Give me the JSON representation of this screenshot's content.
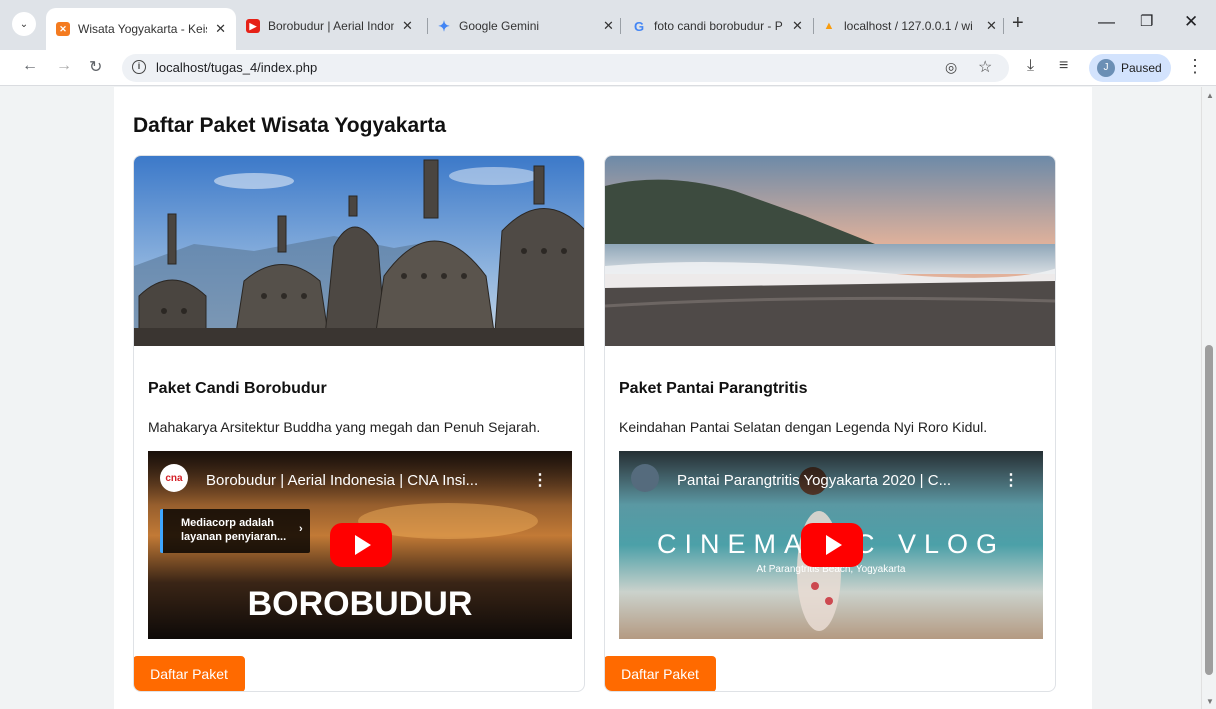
{
  "browser": {
    "tabs": [
      {
        "title": "Wisata Yogyakarta - Keist",
        "active": true
      },
      {
        "title": "Borobudur | Aerial Indone"
      },
      {
        "title": "Google Gemini"
      },
      {
        "title": "foto candi borobudur - P"
      },
      {
        "title": "localhost / 127.0.0.1 / wi"
      }
    ],
    "url": "localhost/tugas_4/index.php",
    "profile_label": "Paused",
    "profile_initial": "J"
  },
  "page": {
    "heading": "Daftar Paket Wisata Yogyakarta",
    "cards": [
      {
        "title": "Paket Candi Borobudur",
        "description": "Mahakarya Arsitektur Buddha yang megah dan Penuh Sejarah.",
        "video": {
          "title": "Borobudur | Aerial Indonesia | CNA Insi...",
          "channel_badge": "cna",
          "info_panel": "Mediacorp adalah layanan penyiaran...",
          "overlay_text": "BOROBUDUR"
        },
        "button_label": "Daftar Paket"
      },
      {
        "title": "Paket Pantai Parangtritis",
        "description": "Keindahan Pantai Selatan dengan Legenda Nyi Roro Kidul.",
        "video": {
          "title": "Pantai Parangtritis Yogyakarta 2020 | C...",
          "overlay_text": "CINEMA   C VLOG",
          "overlay_subtext": "At Parangtritis Beach, Yogyakarta"
        },
        "button_label": "Daftar Paket"
      }
    ]
  },
  "colors": {
    "accent": "#ff6a00",
    "youtube_red": "#ff0000"
  }
}
